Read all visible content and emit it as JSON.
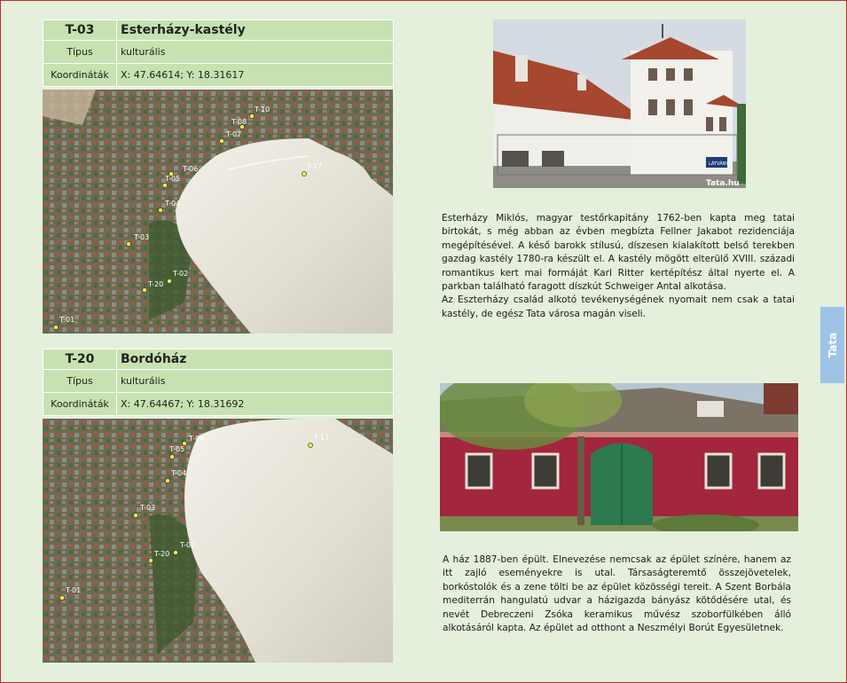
{
  "entry1": {
    "code": "T-03",
    "title": "Esterházy-kastély",
    "type_label": "Típus",
    "type_value": "kulturális",
    "coord_label": "Koordináták",
    "coord_value": "X: 47.64614; Y: 18.31617",
    "photo_credit": "Tata.hu",
    "photo_sign": "LÁTVÁNY",
    "description": [
      "Esterházy Miklós, magyar testőrkapitány 1762-ben kapta meg tatai birtokát, s még abban az évben megbízta Fellner Jakabot rezidenciája megépítésével. A késő barokk stílusú, díszesen kialakított belső terekben gazdag kastély 1780-ra készült el. A kastély mögött elterülő XVIII. századi romantikus kert mai formáját Karl Ritter kertépítész által nyerte el. A parkban található faragott díszkút Schweiger Antal alkotása.",
      "Az Eszterházy család alkotó tevékenységének nyomait nem csak a tatai kastély, de egész Tata városa magán viseli."
    ],
    "map_markers": [
      "T-10",
      "T-08",
      "T-07",
      "T-17",
      "T-06",
      "T-05",
      "T-04",
      "T-03",
      "T-02",
      "T-20",
      "T-01"
    ]
  },
  "entry2": {
    "code": "T-20",
    "title": "Bordóház",
    "type_label": "Típus",
    "type_value": "kulturális",
    "coord_label": "Koordináták",
    "coord_value": "X: 47.64467; Y: 18.31692",
    "description": [
      "A ház 1887-ben épült. Elnevezése nemcsak az épület színére, hanem az itt zajló eseményekre is utal. Társaságteremtő összejövetelek, borkóstolók és a zene tölti be az épület közösségi tereit. A Szent Borbála mediterrán hangulatú udvar a házigazda bányász kötődésére utal, és nevét Debreczeni Zsóka keramikus művész szoborfülkében álló alkotásáról kapta. Az épület ad otthont a Neszmélyi Borút Egyesületnek."
    ],
    "map_markers": [
      "T-17",
      "T-06",
      "T-05",
      "T-04",
      "T-03",
      "T-02",
      "T-20",
      "T-01"
    ]
  },
  "side_tab": "Tata",
  "colors": {
    "table_bg": "#c7e2b0",
    "page_bg": "#e4efdc",
    "tab_bg": "#9dc4e6",
    "border": "#b8322f"
  }
}
